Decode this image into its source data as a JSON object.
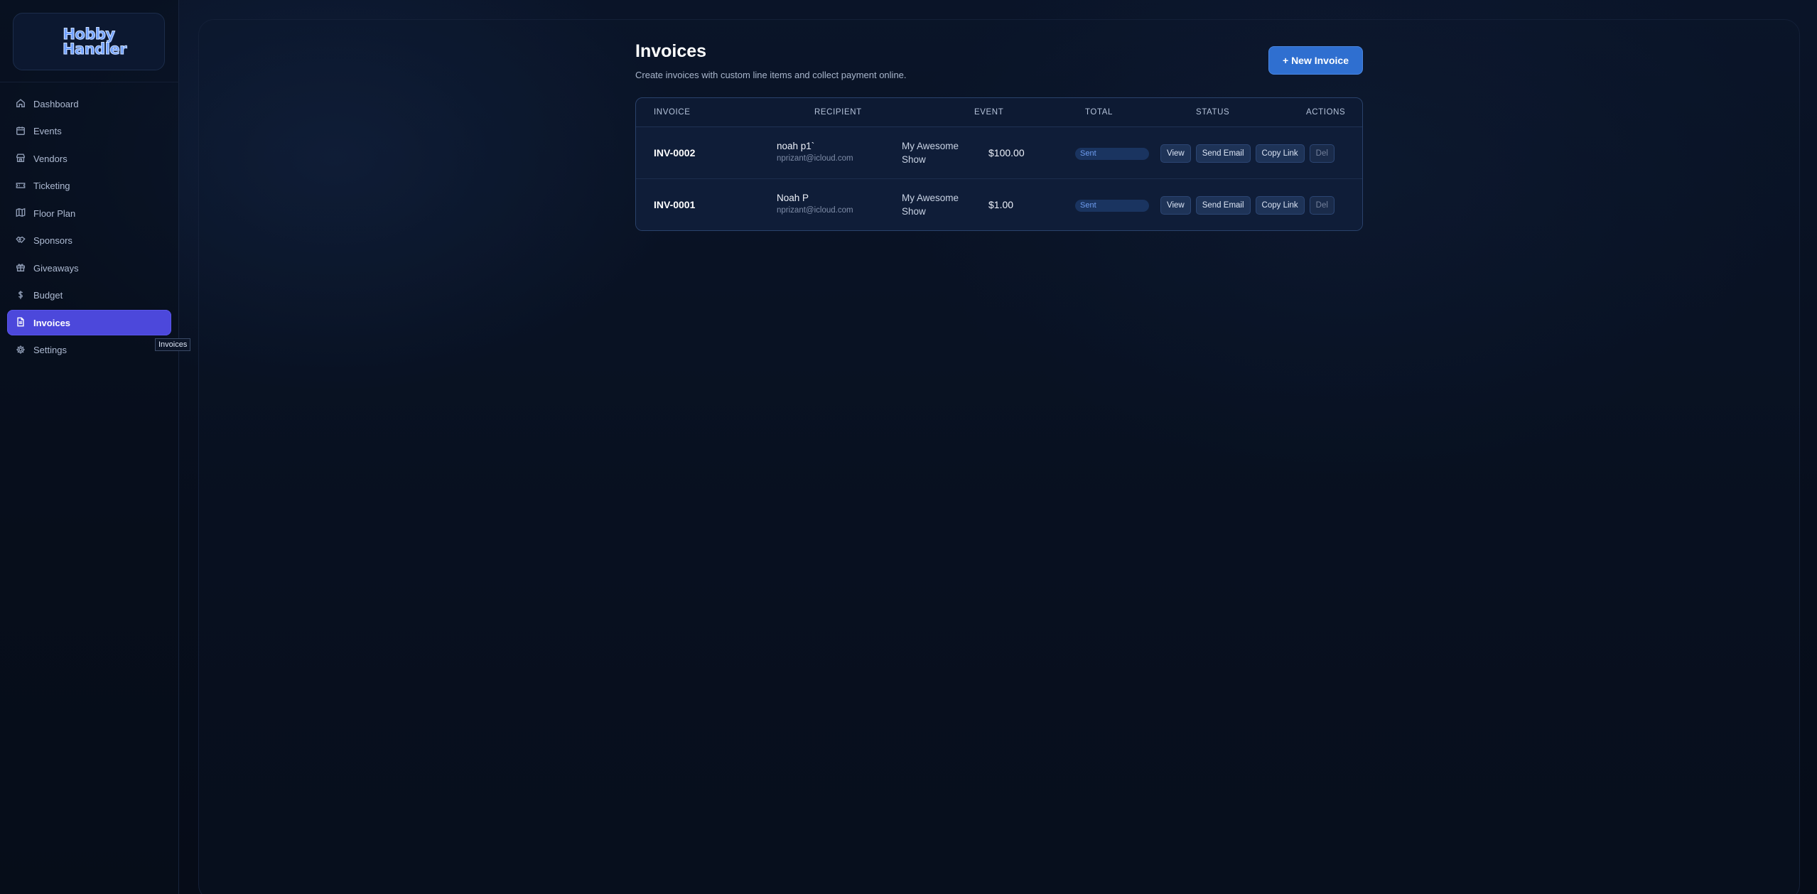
{
  "app": {
    "logo_line1": "Hobby",
    "logo_line2": "Handler",
    "accent": "#4c48db",
    "button_blue": "#2f6fd0"
  },
  "sidebar": {
    "items": [
      {
        "label": "Dashboard",
        "icon": "home-icon"
      },
      {
        "label": "Events",
        "icon": "calendar-icon"
      },
      {
        "label": "Vendors",
        "icon": "store-icon"
      },
      {
        "label": "Ticketing",
        "icon": "ticket-icon"
      },
      {
        "label": "Floor Plan",
        "icon": "map-icon"
      },
      {
        "label": "Sponsors",
        "icon": "handshake-icon"
      },
      {
        "label": "Giveaways",
        "icon": "gift-icon"
      },
      {
        "label": "Budget",
        "icon": "dollar-icon"
      },
      {
        "label": "Invoices",
        "icon": "document-icon",
        "active": true
      },
      {
        "label": "Settings",
        "icon": "gear-icon"
      }
    ],
    "tooltip": "Invoices"
  },
  "page": {
    "title": "Invoices",
    "subtitle": "Create invoices with custom line items and collect payment online.",
    "new_button": "+ New Invoice"
  },
  "table": {
    "headers": {
      "invoice": "INVOICE",
      "recipient": "RECIPIENT",
      "event": "EVENT",
      "total": "TOTAL",
      "status": "STATUS",
      "actions": "ACTIONS"
    },
    "rows": [
      {
        "id": "INV-0002",
        "name": "noah p1`",
        "email": "nprizant@icloud.com",
        "event": "My Awesome Show",
        "total": "$100.00",
        "status": "Sent"
      },
      {
        "id": "INV-0001",
        "name": "Noah P",
        "email": "nprizant@icloud.com",
        "event": "My Awesome Show",
        "total": "$1.00",
        "status": "Sent"
      }
    ],
    "actions": {
      "view": "View",
      "send_email": "Send Email",
      "copy_link": "Copy Link",
      "delete": "Del"
    }
  }
}
